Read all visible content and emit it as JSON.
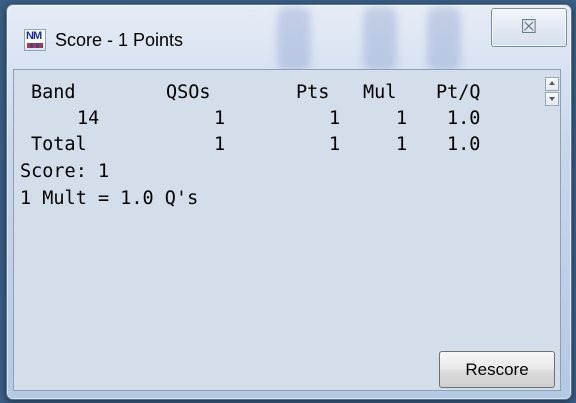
{
  "window": {
    "title": "Score - 1 Points",
    "app_icon_text": "NM",
    "close_glyph": "☒"
  },
  "report": {
    "columns": [
      "Band",
      "QSOs",
      "Pts",
      "Mul",
      "Pt/Q"
    ],
    "rows": [
      [
        "14",
        "1",
        "1",
        "1",
        "1.0"
      ],
      [
        "Total",
        "1",
        "1",
        "1",
        "1.0"
      ]
    ],
    "score_line": "Score: 1",
    "mult_line": "1 Mult = 1.0 Q's"
  },
  "buttons": {
    "rescore": "Rescore"
  }
}
